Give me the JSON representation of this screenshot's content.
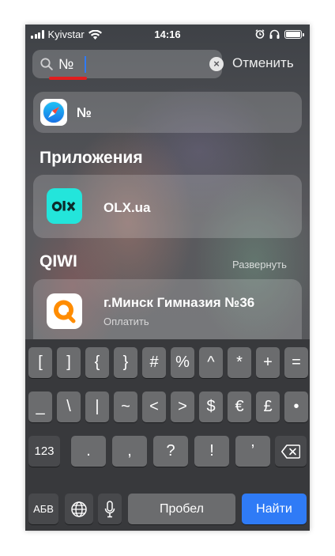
{
  "status_bar": {
    "carrier": "Kyivstar",
    "time": "14:16"
  },
  "search": {
    "query": "№",
    "cancel_label": "Отменить"
  },
  "suggestion": {
    "text": "№"
  },
  "sections": {
    "apps_title": "Приложения",
    "qiwi_title": "QIWI",
    "qiwi_expand": "Развернуть"
  },
  "apps": [
    {
      "name": "OLX.ua"
    }
  ],
  "qiwi": {
    "title": "г.Минск Гимназия №36",
    "subtitle": "Оплатить"
  },
  "keyboard": {
    "row1": [
      "[",
      "]",
      "{",
      "}",
      "#",
      "%",
      "^",
      "*",
      "+",
      "="
    ],
    "row2": [
      "_",
      "\\",
      "|",
      "~",
      "<",
      ">",
      "$",
      "€",
      "£",
      "•"
    ],
    "row3": {
      "mode": "123",
      "keys": [
        ".",
        ",",
        "?",
        "!",
        "’"
      ]
    },
    "row4": {
      "lang": "АБВ",
      "space": "Пробел",
      "go": "Найти"
    }
  },
  "colors": {
    "accent": "#2f7bf6",
    "olx_brand": "#23e5db",
    "qiwi_brand": "#ff8c00",
    "highlight": "#e21e1e"
  },
  "icons": [
    "search-icon",
    "clear-icon",
    "safari-icon",
    "olx-icon",
    "qiwi-icon",
    "globe-icon",
    "microphone-icon",
    "backspace-icon",
    "wifi-icon",
    "alarm-icon",
    "headphones-icon",
    "battery-icon"
  ]
}
